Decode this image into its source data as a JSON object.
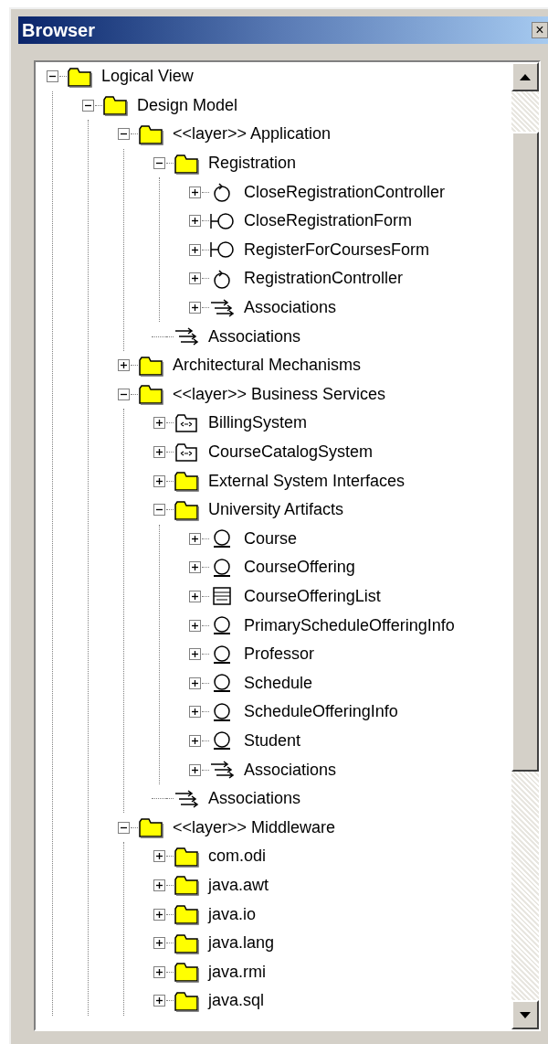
{
  "window": {
    "title": "Browser",
    "close_glyph": "×"
  },
  "tree": [
    {
      "label": "Logical View",
      "kind": "folder",
      "expanded": true,
      "children": [
        {
          "label": "Design Model",
          "kind": "folder",
          "expanded": true,
          "children": [
            {
              "label": "<<layer>> Application",
              "kind": "folder",
              "expanded": true,
              "children": [
                {
                  "label": "Registration",
                  "kind": "folder",
                  "expanded": true,
                  "children": [
                    {
                      "label": "CloseRegistrationController",
                      "kind": "controller",
                      "expanded": false
                    },
                    {
                      "label": "CloseRegistrationForm",
                      "kind": "boundary",
                      "expanded": false
                    },
                    {
                      "label": "RegisterForCoursesForm",
                      "kind": "boundary",
                      "expanded": false
                    },
                    {
                      "label": "RegistrationController",
                      "kind": "controller",
                      "expanded": false
                    },
                    {
                      "label": "Associations",
                      "kind": "associations",
                      "expanded": false
                    }
                  ]
                },
                {
                  "label": "Associations",
                  "kind": "associations"
                }
              ]
            },
            {
              "label": "Architectural Mechanisms",
              "kind": "folder",
              "expanded": false
            },
            {
              "label": "<<layer>> Business Services",
              "kind": "folder",
              "expanded": true,
              "children": [
                {
                  "label": "BillingSystem",
                  "kind": "subsystem",
                  "expanded": false
                },
                {
                  "label": "CourseCatalogSystem",
                  "kind": "subsystem",
                  "expanded": false
                },
                {
                  "label": "External System Interfaces",
                  "kind": "folder",
                  "expanded": false
                },
                {
                  "label": "University Artifacts",
                  "kind": "folder",
                  "expanded": true,
                  "children": [
                    {
                      "label": "Course",
                      "kind": "entity",
                      "expanded": false
                    },
                    {
                      "label": "CourseOffering",
                      "kind": "entity",
                      "expanded": false
                    },
                    {
                      "label": "CourseOfferingList",
                      "kind": "utility",
                      "expanded": false
                    },
                    {
                      "label": "PrimaryScheduleOfferingInfo",
                      "kind": "entity",
                      "expanded": false
                    },
                    {
                      "label": "Professor",
                      "kind": "entity",
                      "expanded": false
                    },
                    {
                      "label": "Schedule",
                      "kind": "entity",
                      "expanded": false
                    },
                    {
                      "label": "ScheduleOfferingInfo",
                      "kind": "entity",
                      "expanded": false
                    },
                    {
                      "label": "Student",
                      "kind": "entity",
                      "expanded": false
                    },
                    {
                      "label": "Associations",
                      "kind": "associations",
                      "expanded": false
                    }
                  ]
                },
                {
                  "label": "Associations",
                  "kind": "associations"
                }
              ]
            },
            {
              "label": "<<layer>> Middleware",
              "kind": "folder",
              "expanded": true,
              "children": [
                {
                  "label": "com.odi",
                  "kind": "folder",
                  "expanded": false
                },
                {
                  "label": "java.awt",
                  "kind": "folder",
                  "expanded": false
                },
                {
                  "label": "java.io",
                  "kind": "folder",
                  "expanded": false
                },
                {
                  "label": "java.lang",
                  "kind": "folder",
                  "expanded": false
                },
                {
                  "label": "java.rmi",
                  "kind": "folder",
                  "expanded": false
                },
                {
                  "label": "java.sql",
                  "kind": "folder",
                  "expanded": false
                }
              ]
            }
          ]
        }
      ]
    }
  ]
}
